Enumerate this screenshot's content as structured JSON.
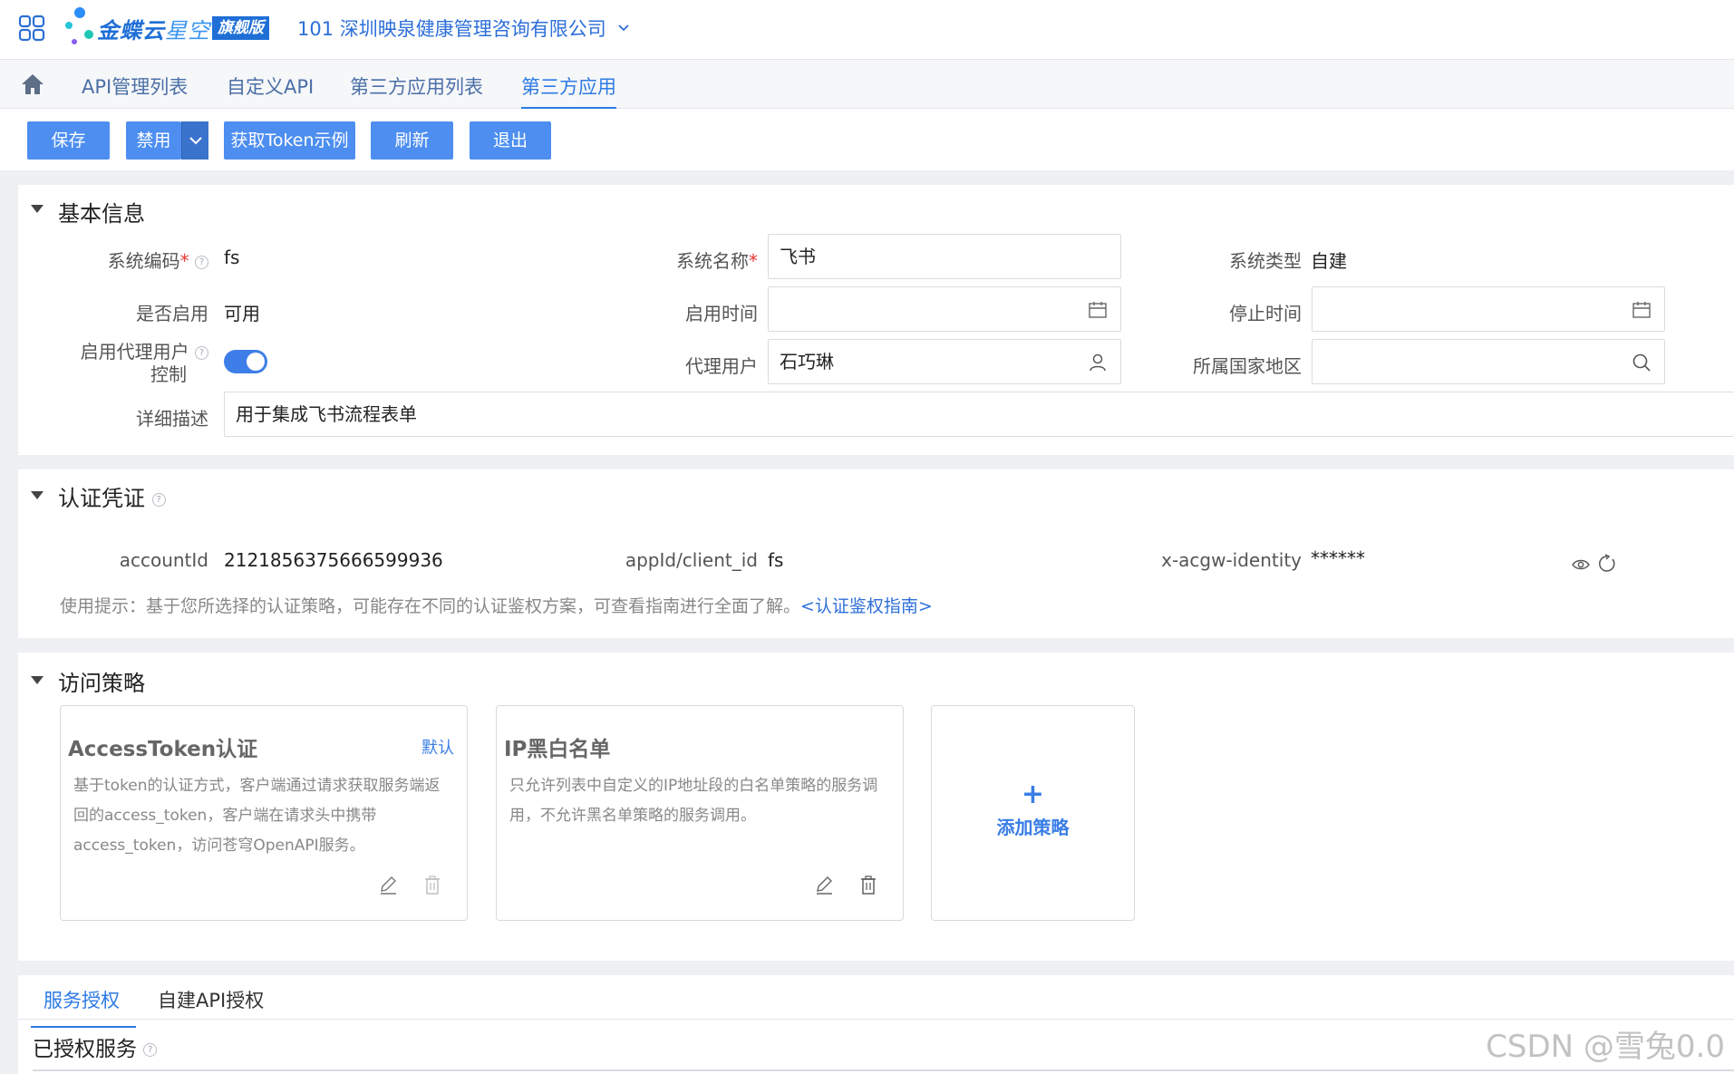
{
  "header": {
    "logo_brand": "金蝶云",
    "logo_product": "星空",
    "logo_edition": "旗舰版",
    "org_name": "101 深圳映泉健康管理咨询有限公司"
  },
  "tabs": [
    {
      "label": "API管理列表"
    },
    {
      "label": "自定义API"
    },
    {
      "label": "第三方应用列表"
    },
    {
      "label": "第三方应用"
    }
  ],
  "toolbar": {
    "save": "保存",
    "disable": "禁用",
    "token_example": "获取Token示例",
    "refresh": "刷新",
    "exit": "退出"
  },
  "basic_info": {
    "title": "基本信息",
    "system_code_label": "系统编码",
    "system_code_value": "fs",
    "system_name_label": "系统名称",
    "system_name_value": "飞书",
    "system_type_label": "系统类型",
    "system_type_value": "自建",
    "enabled_label": "是否启用",
    "enabled_value": "可用",
    "start_time_label": "启用时间",
    "start_time_value": "",
    "stop_time_label": "停止时间",
    "stop_time_value": "",
    "proxy_control_label_1": "启用代理用户",
    "proxy_control_label_2": "控制",
    "proxy_control_on": true,
    "proxy_user_label": "代理用户",
    "proxy_user_value": "石巧琳",
    "region_label": "所属国家地区",
    "region_value": "",
    "desc_label": "详细描述",
    "desc_value": "用于集成飞书流程表单"
  },
  "credentials": {
    "title": "认证凭证",
    "account_label": "accountId",
    "account_value": "2121856375666599936",
    "appid_label": "appId/client_id",
    "appid_value": "fs",
    "identity_label": "x-acgw-identity",
    "identity_value": "******",
    "tip": "使用提示：基于您所选择的认证策略，可能存在不同的认证鉴权方案，可查看指南进行全面了解。",
    "tip_link": "<认证鉴权指南>"
  },
  "access_policy": {
    "title": "访问策略",
    "policies": [
      {
        "title": "AccessToken认证",
        "tag": "默认",
        "desc": "基于token的认证方式，客户端通过请求获取服务端返回的access_token，客户端在请求头中携带access_token，访问苍穹OpenAPI服务。"
      },
      {
        "title": "IP黑白名单",
        "tag": "",
        "desc": "只允许列表中自定义的IP地址段的白名单策略的服务调用，不允许黑名单策略的服务调用。"
      }
    ],
    "add_plus": "+",
    "add_label": "添加策略"
  },
  "bottom": {
    "tab_service": "服务授权",
    "tab_custom_api": "自建API授权",
    "authorized_title": "已授权服务"
  },
  "watermark": "CSDN @雪兔0.0",
  "colors": {
    "primary": "#4d8ef0",
    "link": "#2d7be5",
    "required": "#e53935"
  }
}
